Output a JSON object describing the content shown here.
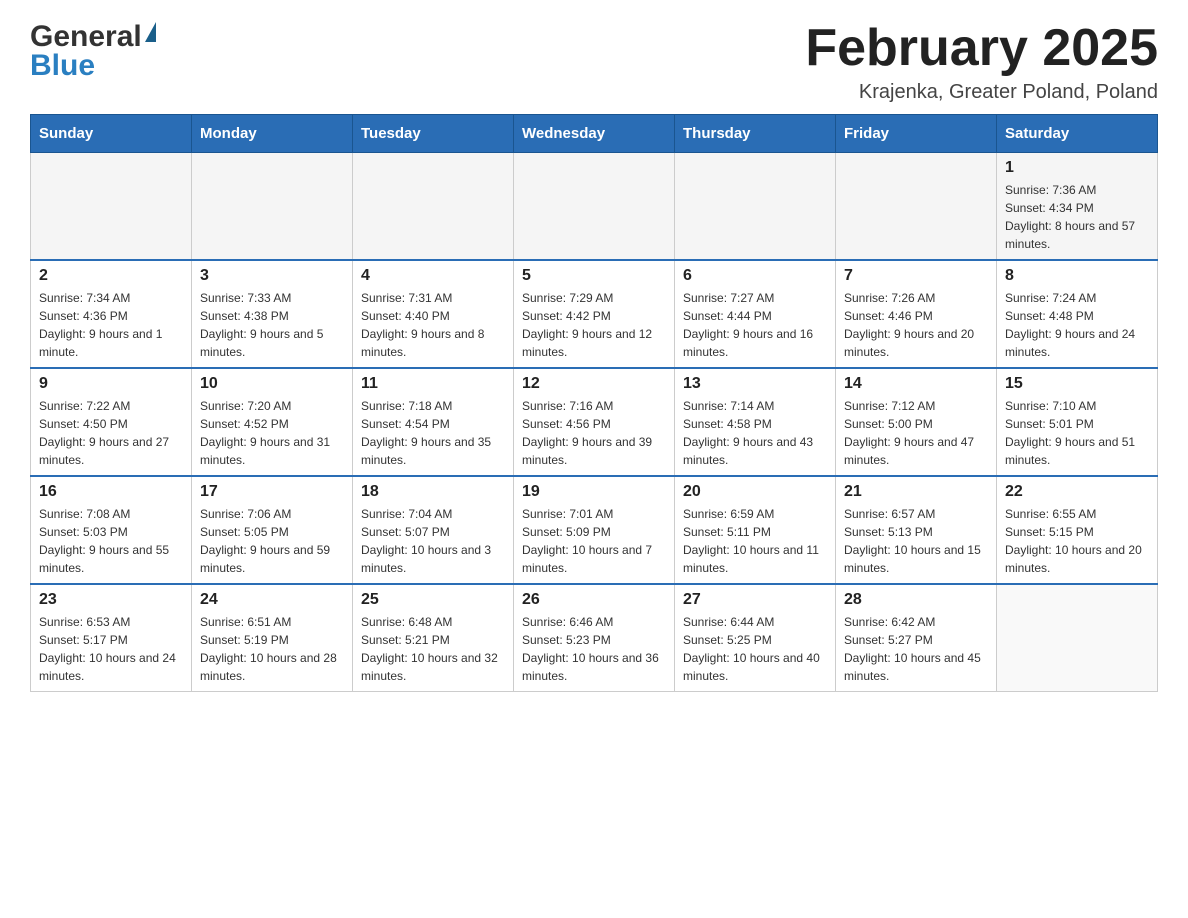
{
  "header": {
    "logo_general": "General",
    "logo_blue": "Blue",
    "month_title": "February 2025",
    "location": "Krajenka, Greater Poland, Poland"
  },
  "weekdays": [
    "Sunday",
    "Monday",
    "Tuesday",
    "Wednesday",
    "Thursday",
    "Friday",
    "Saturday"
  ],
  "weeks": [
    [
      {
        "day": "",
        "info": ""
      },
      {
        "day": "",
        "info": ""
      },
      {
        "day": "",
        "info": ""
      },
      {
        "day": "",
        "info": ""
      },
      {
        "day": "",
        "info": ""
      },
      {
        "day": "",
        "info": ""
      },
      {
        "day": "1",
        "info": "Sunrise: 7:36 AM\nSunset: 4:34 PM\nDaylight: 8 hours and 57 minutes."
      }
    ],
    [
      {
        "day": "2",
        "info": "Sunrise: 7:34 AM\nSunset: 4:36 PM\nDaylight: 9 hours and 1 minute."
      },
      {
        "day": "3",
        "info": "Sunrise: 7:33 AM\nSunset: 4:38 PM\nDaylight: 9 hours and 5 minutes."
      },
      {
        "day": "4",
        "info": "Sunrise: 7:31 AM\nSunset: 4:40 PM\nDaylight: 9 hours and 8 minutes."
      },
      {
        "day": "5",
        "info": "Sunrise: 7:29 AM\nSunset: 4:42 PM\nDaylight: 9 hours and 12 minutes."
      },
      {
        "day": "6",
        "info": "Sunrise: 7:27 AM\nSunset: 4:44 PM\nDaylight: 9 hours and 16 minutes."
      },
      {
        "day": "7",
        "info": "Sunrise: 7:26 AM\nSunset: 4:46 PM\nDaylight: 9 hours and 20 minutes."
      },
      {
        "day": "8",
        "info": "Sunrise: 7:24 AM\nSunset: 4:48 PM\nDaylight: 9 hours and 24 minutes."
      }
    ],
    [
      {
        "day": "9",
        "info": "Sunrise: 7:22 AM\nSunset: 4:50 PM\nDaylight: 9 hours and 27 minutes."
      },
      {
        "day": "10",
        "info": "Sunrise: 7:20 AM\nSunset: 4:52 PM\nDaylight: 9 hours and 31 minutes."
      },
      {
        "day": "11",
        "info": "Sunrise: 7:18 AM\nSunset: 4:54 PM\nDaylight: 9 hours and 35 minutes."
      },
      {
        "day": "12",
        "info": "Sunrise: 7:16 AM\nSunset: 4:56 PM\nDaylight: 9 hours and 39 minutes."
      },
      {
        "day": "13",
        "info": "Sunrise: 7:14 AM\nSunset: 4:58 PM\nDaylight: 9 hours and 43 minutes."
      },
      {
        "day": "14",
        "info": "Sunrise: 7:12 AM\nSunset: 5:00 PM\nDaylight: 9 hours and 47 minutes."
      },
      {
        "day": "15",
        "info": "Sunrise: 7:10 AM\nSunset: 5:01 PM\nDaylight: 9 hours and 51 minutes."
      }
    ],
    [
      {
        "day": "16",
        "info": "Sunrise: 7:08 AM\nSunset: 5:03 PM\nDaylight: 9 hours and 55 minutes."
      },
      {
        "day": "17",
        "info": "Sunrise: 7:06 AM\nSunset: 5:05 PM\nDaylight: 9 hours and 59 minutes."
      },
      {
        "day": "18",
        "info": "Sunrise: 7:04 AM\nSunset: 5:07 PM\nDaylight: 10 hours and 3 minutes."
      },
      {
        "day": "19",
        "info": "Sunrise: 7:01 AM\nSunset: 5:09 PM\nDaylight: 10 hours and 7 minutes."
      },
      {
        "day": "20",
        "info": "Sunrise: 6:59 AM\nSunset: 5:11 PM\nDaylight: 10 hours and 11 minutes."
      },
      {
        "day": "21",
        "info": "Sunrise: 6:57 AM\nSunset: 5:13 PM\nDaylight: 10 hours and 15 minutes."
      },
      {
        "day": "22",
        "info": "Sunrise: 6:55 AM\nSunset: 5:15 PM\nDaylight: 10 hours and 20 minutes."
      }
    ],
    [
      {
        "day": "23",
        "info": "Sunrise: 6:53 AM\nSunset: 5:17 PM\nDaylight: 10 hours and 24 minutes."
      },
      {
        "day": "24",
        "info": "Sunrise: 6:51 AM\nSunset: 5:19 PM\nDaylight: 10 hours and 28 minutes."
      },
      {
        "day": "25",
        "info": "Sunrise: 6:48 AM\nSunset: 5:21 PM\nDaylight: 10 hours and 32 minutes."
      },
      {
        "day": "26",
        "info": "Sunrise: 6:46 AM\nSunset: 5:23 PM\nDaylight: 10 hours and 36 minutes."
      },
      {
        "day": "27",
        "info": "Sunrise: 6:44 AM\nSunset: 5:25 PM\nDaylight: 10 hours and 40 minutes."
      },
      {
        "day": "28",
        "info": "Sunrise: 6:42 AM\nSunset: 5:27 PM\nDaylight: 10 hours and 45 minutes."
      },
      {
        "day": "",
        "info": ""
      }
    ]
  ]
}
